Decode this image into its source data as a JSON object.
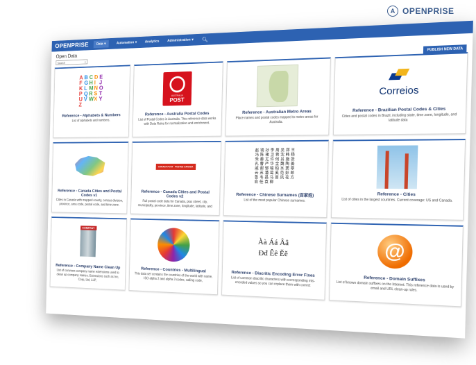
{
  "brand": {
    "text": "OPENPRISE",
    "icon": "A"
  },
  "nav": {
    "logo": "OPENPRISE",
    "items": [
      "Data",
      "Automation",
      "Analytics",
      "Administration"
    ],
    "search_icon": "search-icon"
  },
  "page": {
    "title": "Open Data",
    "search_placeholder": "Search",
    "publish_label": "PUBLISH NEW DATA"
  },
  "cards": [
    {
      "title": "Reference - Alphabets & Numbers",
      "desc": "List of alphabets and numbers."
    },
    {
      "title": "Reference - Australia Postal Codes",
      "desc": "List of Postal Codes in Australia. This reference data works with Data Rules for normalization and enrichment."
    },
    {
      "title": "Reference - Australian Metro Areas",
      "desc": "Place names and postal codes mapped to metro areas for Australia."
    },
    {
      "title": "Reference - Brazilian Postal Codes & Cities",
      "desc": "Cities and postal codes in Brazil, including state, time zone, longitude, and latitude data"
    },
    {
      "title": "Reference - Canada Cities and Postal Codes v1",
      "desc": "Cities in Canada with mapped county, census division, province, area code, postal code, and time zone."
    },
    {
      "title": "Reference - Canada Cities and Postal Codes v2",
      "desc": "Full postal code data for Canada, plus street, city, municipality, province, time zone, longitude, latitude, and"
    },
    {
      "title": "Reference - Chinese Surnames (百家姓)",
      "desc": "List of the most popular Chinese surnames."
    },
    {
      "title": "Reference - Cities",
      "desc": "List of cities in the largest countries. Current coverage: US and Canada."
    },
    {
      "title": "Reference - Company Name Clean Up",
      "desc": "List of common company name extensions used to clean up company names. Extensions such as Inc, Corp, Ltd, LLP,"
    },
    {
      "title": "Reference - Countries - Multilingual",
      "desc": "This data set contains the countries of the world with name, ISO alpha 2 and alpha 3 codes, calling code,"
    },
    {
      "title": "Reference - Diacritic Encoding Error Fixes",
      "desc": "List of common diacritic characters with corresponding mis-encoded values so you can replace them with correct"
    },
    {
      "title": "Reference - Domain Suffixes",
      "desc": "List of known domain suffixes on the Internet. This reference data is used by email and URL clean-up rules."
    }
  ],
  "thumbs": {
    "alphabet": [
      "A",
      "B",
      "C",
      "D",
      "E",
      "F",
      "G",
      "H",
      "I",
      "J",
      "K",
      "L",
      "M",
      "N",
      "O",
      "P",
      "Q",
      "R",
      "S",
      "T",
      "U",
      "V",
      "W",
      "X",
      "Y",
      "Z"
    ],
    "auspost_small": "AUSTRALIA",
    "auspost_big": "POST",
    "correios": "Correios",
    "canpost": [
      "CANADA POST",
      "POSTES CANADA"
    ],
    "chinese": "赵钱孙李周吴郑王冯陈褚卫蒋沈韩杨朱秦尤许何吕施张孔曹严华金魏陶姜戚谢邹喻柏水窦章云苏潘葛奚范彭郎鲁韦昌马苗凤花方俞任袁柳",
    "company_sign": "COMPANY",
    "diacritics": [
      "Àà Áá Ââ",
      "Ðđ Êê Ěě"
    ],
    "at": "@"
  },
  "colors": {
    "nav": "#2d62b2",
    "title": "#2a3e6a",
    "publish": "#2d62b2"
  }
}
